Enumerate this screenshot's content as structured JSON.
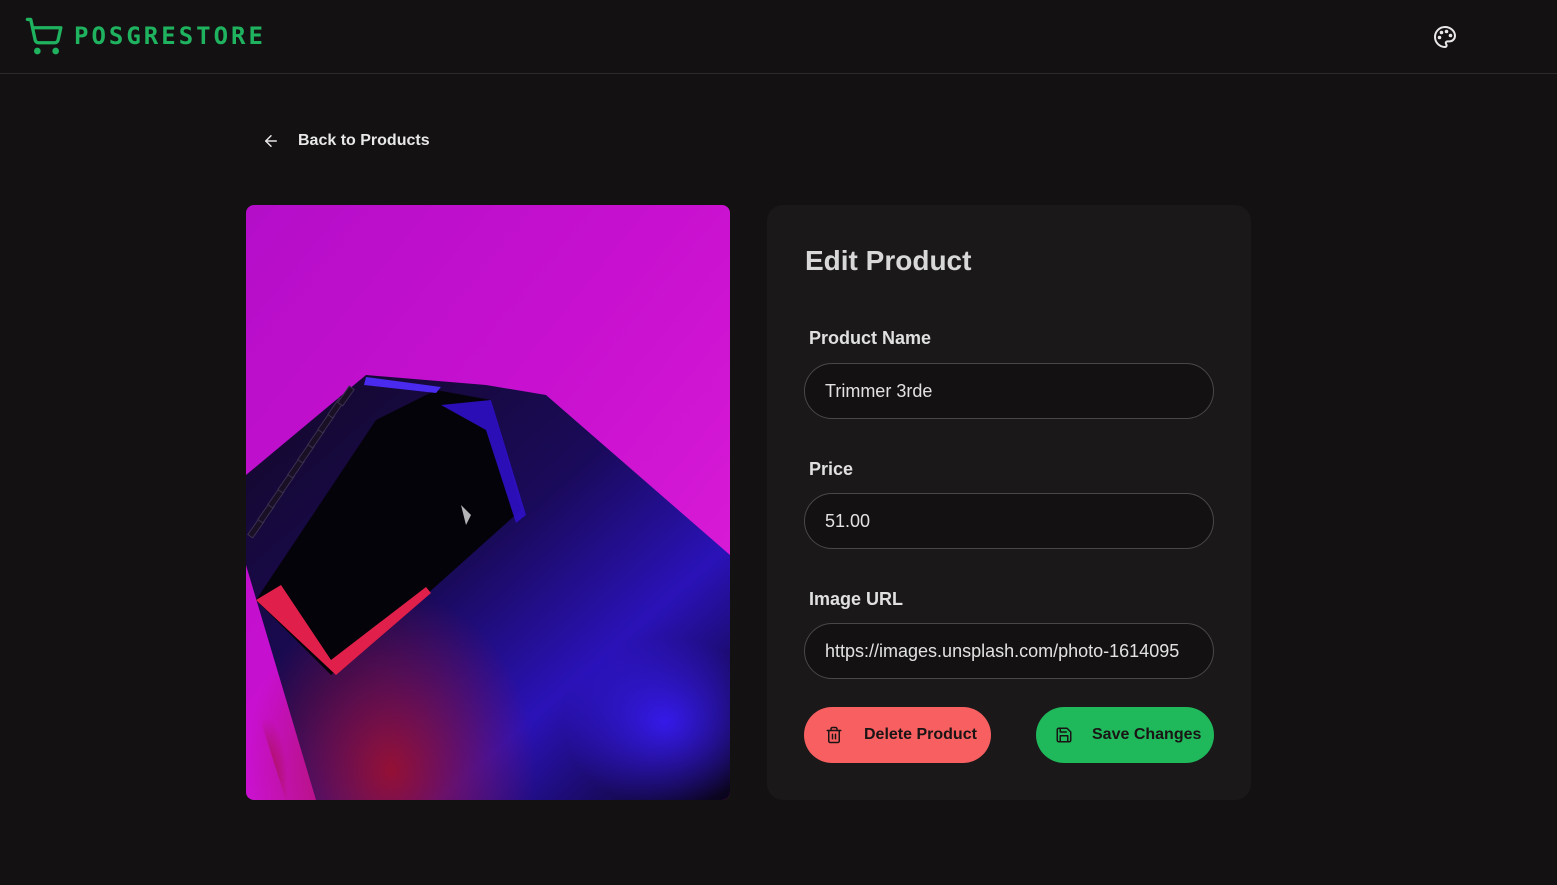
{
  "navbar": {
    "brand_name": "POSGRESTORE",
    "brand_icon": "shopping-cart-icon",
    "theme_icon": "palette-icon"
  },
  "back_link": {
    "label": "Back to Products",
    "icon": "arrow-left-icon"
  },
  "product_image": {
    "alt": "Trimmer 3rde"
  },
  "form": {
    "title": "Edit Product",
    "fields": [
      {
        "label": "Product Name",
        "value": "Trimmer 3rde"
      },
      {
        "label": "Price",
        "value": "51.00"
      },
      {
        "label": "Image URL",
        "value": "https://images.unsplash.com/photo-1614095"
      }
    ],
    "delete_label": "Delete Product",
    "delete_icon": "trash-icon",
    "save_label": "Save Changes",
    "save_icon": "save-icon"
  },
  "colors": {
    "accent": "#1fb25f",
    "danger": "#f85f61",
    "background": "#141112",
    "card": "#1b1819"
  }
}
